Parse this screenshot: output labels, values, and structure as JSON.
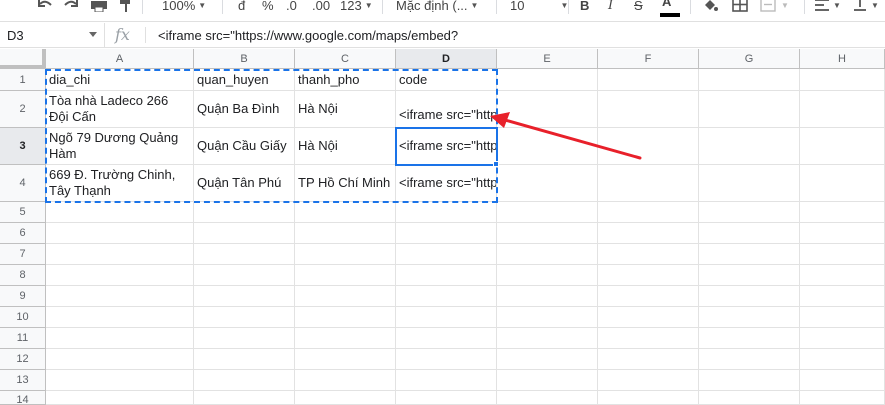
{
  "toolbar": {
    "zoom": "100%",
    "currency_symbol": "đ",
    "percent_symbol": "%",
    "decrease_decimal": ".0",
    "increase_decimal": ".00",
    "more_formats": "123",
    "font_family": "Mặc định (...",
    "font_size": "10",
    "bold": "B",
    "italic": "I",
    "text_color": "A"
  },
  "formula_bar": {
    "name_box": "D3",
    "fx_label": "fx",
    "content": "<iframe src=\"https://www.google.com/maps/embed?"
  },
  "columns": [
    "A",
    "B",
    "C",
    "D",
    "E",
    "F",
    "G",
    "H"
  ],
  "rows": [
    "1",
    "2",
    "3",
    "4",
    "5",
    "6",
    "7",
    "8",
    "9",
    "10",
    "11",
    "12",
    "13",
    "14"
  ],
  "cells": {
    "A1": "dia_chi",
    "B1": "quan_huyen",
    "C1": "thanh_pho",
    "D1": "code",
    "A2": "Tòa nhà Ladeco 266 Đội Cấn",
    "B2": "Quận Ba Đình",
    "C2": "Hà Nội",
    "D2": "<iframe src=\"https://www.google.com/maps/embed?",
    "A3": "Ngõ 79 Dương Quảng Hàm",
    "B3": "Quận Cầu Giấy",
    "C3": "Hà Nội",
    "D3": "<iframe src=\"https://www.google.com/maps/embed?",
    "A4": "669 Đ. Trường Chinh, Tây Thạnh",
    "B4": "Quận Tân Phú",
    "C4": "TP Hồ Chí Minh",
    "D4": "<iframe src=\"https://www.google.com/maps/embed?"
  },
  "colors": {
    "selection": "#1a73e8",
    "annotation_arrow": "#e8202a"
  }
}
